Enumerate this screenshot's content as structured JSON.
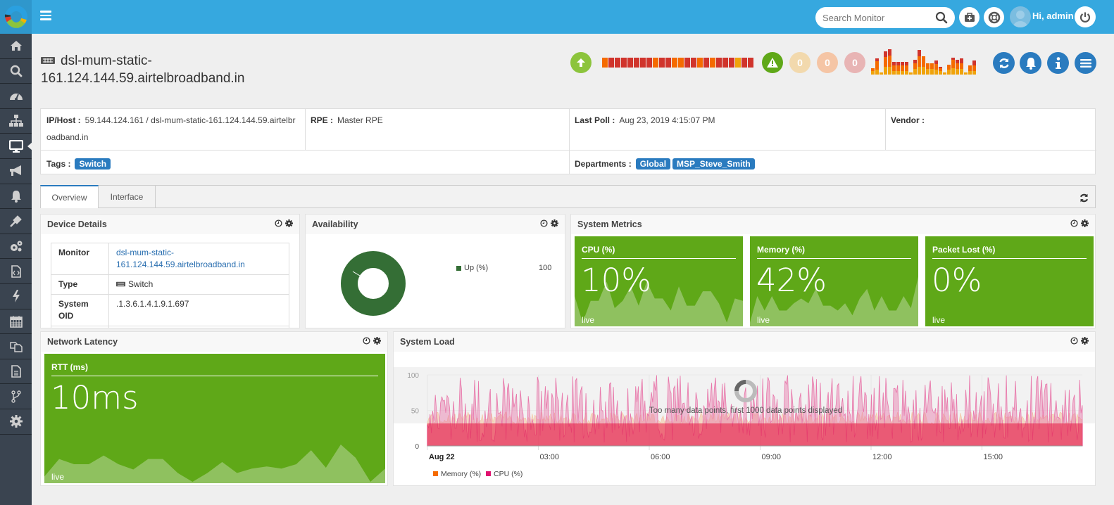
{
  "topbar": {
    "search_placeholder": "Search Monitor",
    "greeting": "Hi, admin",
    "icons": [
      "hamburger-icon",
      "search-icon",
      "first-aid-kit-icon",
      "lifebuoy-icon",
      "user-avatar",
      "power-icon"
    ]
  },
  "sidebar": {
    "items": [
      {
        "name": "home",
        "icon": "home-icon"
      },
      {
        "name": "search",
        "icon": "search-icon"
      },
      {
        "name": "dashboard",
        "icon": "dashboard-icon"
      },
      {
        "name": "topology",
        "icon": "sitemap-icon"
      },
      {
        "name": "monitor",
        "icon": "desktop-icon",
        "active": true
      },
      {
        "name": "alerts",
        "icon": "bullhorn-icon"
      },
      {
        "name": "notifications",
        "icon": "bell-icon"
      },
      {
        "name": "plugins",
        "icon": "plug-icon"
      },
      {
        "name": "settings",
        "icon": "cogs-icon"
      },
      {
        "name": "reports",
        "icon": "code-file-icon"
      },
      {
        "name": "actions",
        "icon": "bolt-icon"
      },
      {
        "name": "schedule",
        "icon": "calendar-icon"
      },
      {
        "name": "copies",
        "icon": "copy-icon"
      },
      {
        "name": "documents",
        "icon": "document-icon"
      },
      {
        "name": "workflow",
        "icon": "branch-icon"
      },
      {
        "name": "admin",
        "icon": "gear-icon"
      }
    ]
  },
  "header": {
    "device_name_line1": "dsl-mum-static-",
    "device_name_line2": "161.124.144.59.airtelbroadband.in",
    "status_icon": "arrow-up-icon",
    "availability_strip": [
      "#f56b00",
      "#d0342c",
      "#d0342c",
      "#d0342c",
      "#d0342c",
      "#d0342c",
      "#d0342c",
      "#d0342c",
      "#f56b00",
      "#d0342c",
      "#d0342c",
      "#f56b00",
      "#f56b00",
      "#d0342c",
      "#d0342c",
      "#f56b00",
      "#d0342c",
      "#f56b00",
      "#d0342c",
      "#d0342c",
      "#d0342c",
      "#f0a30a",
      "#d0342c",
      "#d0342c"
    ],
    "alert_counts": [
      {
        "value": "0",
        "color": "#f2d9ad"
      },
      {
        "value": "0",
        "color": "#f5c5a5"
      },
      {
        "value": "0",
        "color": "#e8b4b4"
      }
    ],
    "alert_history_bars": [
      [
        0.25,
        0.15,
        0
      ],
      [
        0.3,
        0.55,
        0.2
      ],
      [
        0.15,
        0,
        0
      ],
      [
        0.5,
        0.65,
        0.35
      ],
      [
        0.5,
        0.75,
        0.4
      ],
      [
        0.25,
        0.35,
        0.2
      ],
      [
        0.25,
        0.35,
        0.2
      ],
      [
        0.25,
        0.35,
        0.2
      ],
      [
        0.25,
        0.35,
        0.2
      ],
      [
        0.15,
        0,
        0
      ],
      [
        0.35,
        0.4,
        0.2
      ],
      [
        0.5,
        0.7,
        0.4
      ],
      [
        0.5,
        0.7,
        0
      ],
      [
        0.35,
        0.4,
        0
      ],
      [
        0.35,
        0.4,
        0
      ],
      [
        0.3,
        0.4,
        0.2
      ],
      [
        0.25,
        0.15,
        0.1
      ],
      [
        0.15,
        0,
        0
      ],
      [
        0.3,
        0.35,
        0
      ],
      [
        0.4,
        0.55,
        0.15
      ],
      [
        0.35,
        0.4,
        0.2
      ],
      [
        0.35,
        0.4,
        0.3
      ],
      [
        0.15,
        0,
        0
      ],
      [
        0.25,
        0.35,
        0
      ],
      [
        0.25,
        0.35,
        0.3
      ]
    ],
    "actions": [
      "refresh-icon",
      "bell-icon",
      "info-icon",
      "menu-icon"
    ]
  },
  "info": {
    "ip_host_label": "IP/Host :",
    "ip_host_value_1": "59.144.124.161 / dsl-mum-static-161.124.144.59.airtelbr",
    "ip_host_value_2": "oadband.in",
    "rpe_label": "RPE :",
    "rpe_value": "Master RPE",
    "last_poll_label": "Last Poll :",
    "last_poll_value": "Aug 23, 2019 4:15:07 PM",
    "vendor_label": "Vendor :",
    "vendor_value": "",
    "tags_label": "Tags :",
    "tags": [
      "Switch"
    ],
    "departments_label": "Departments :",
    "departments": [
      "Global",
      "MSP_Steve_Smith"
    ]
  },
  "tabs": [
    {
      "label": "Overview",
      "active": true
    },
    {
      "label": "Interface",
      "active": false
    }
  ],
  "device_details": {
    "title": "Device Details",
    "rows": [
      {
        "key": "Monitor",
        "value_1": "dsl-mum-static-",
        "value_2": "161.124.144.59.airtelbroadband.in"
      },
      {
        "key": "Type",
        "value": "Switch"
      },
      {
        "key_1": "System",
        "key_2": "OID",
        "value": ".1.3.6.1.4.1.9.1.697"
      }
    ]
  },
  "availability": {
    "title": "Availability",
    "legend": [
      {
        "label": "Up (%)",
        "value": "100",
        "color": "#346e35"
      }
    ]
  },
  "system_metrics": {
    "title": "System Metrics",
    "tiles": [
      {
        "label": "CPU (%)",
        "value": "10%",
        "live": "live",
        "spark": [
          0.6,
          0.05,
          0.5,
          0.5,
          0.9,
          0.35,
          0.5,
          0.8,
          0.4,
          0.9,
          0.55,
          0.55,
          0.3,
          0.8,
          0.4,
          0.4,
          0.7,
          0.7,
          0.45,
          0.05,
          0.55,
          0.5
        ]
      },
      {
        "label": "Memory (%)",
        "value": "42%",
        "live": "live",
        "spark": [
          0.05,
          0.6,
          0.3,
          0.6,
          0.3,
          0.3,
          0.45,
          0.55,
          0.45,
          0.75,
          0.4,
          0.4,
          0.3,
          0.45,
          0.2,
          0.55,
          0.75,
          0.3,
          0.6,
          0.3,
          0.3,
          0.6,
          0.35,
          1.0
        ]
      },
      {
        "label": "Packet Lost (%)",
        "value": "0%",
        "live": "live",
        "spark": []
      }
    ]
  },
  "network_latency": {
    "title": "Network Latency",
    "tile": {
      "label": "RTT (ms)",
      "value": "10ms",
      "live": "live",
      "spark": [
        0.12,
        0.52,
        0.4,
        0.4,
        0.6,
        0.4,
        0.28,
        0.52,
        0.52,
        0.2,
        0.0,
        0.2,
        0.45,
        0.2,
        0.3,
        0.35,
        0.3,
        0.4,
        0.72,
        0.32,
        0.85,
        0.55,
        0.0,
        0.3
      ]
    }
  },
  "chart_data": {
    "type": "area",
    "title": "System Load",
    "note": "Too many data points, first 1000 data points displayed",
    "x_tick_labels": [
      "Aug 22",
      "03:00",
      "06:00",
      "09:00",
      "12:00",
      "15:00"
    ],
    "y_tick_labels": [
      "0",
      "50",
      "100"
    ],
    "ylim": [
      0,
      100
    ],
    "grid": true,
    "legend_position": "bottom-left",
    "series": [
      {
        "name": "Memory (%)",
        "color": "#f56b00",
        "approx_range": [
          30,
          50
        ]
      },
      {
        "name": "CPU (%)",
        "color": "#e0126f",
        "approx_range": [
          0,
          100
        ]
      }
    ]
  },
  "panel_icons": [
    "clock-icon",
    "gear-icon"
  ]
}
